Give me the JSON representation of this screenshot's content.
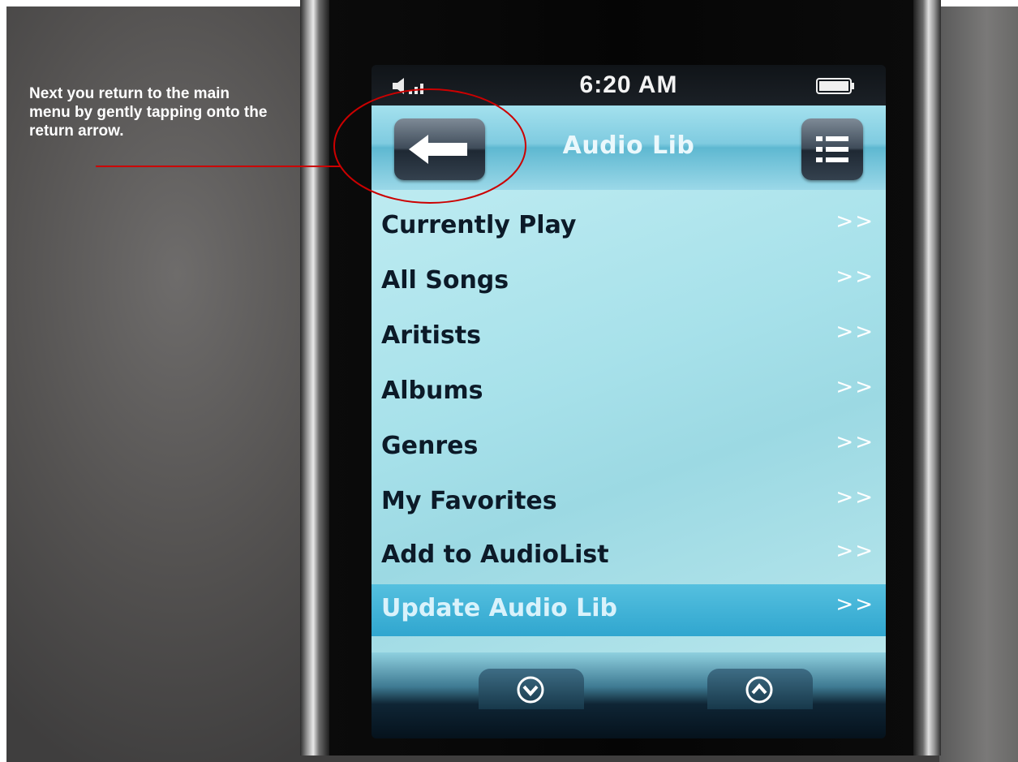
{
  "annotation": {
    "text": "Next you return to the main menu by gently tapping onto the return arrow.",
    "color": "#cc0000"
  },
  "status_bar": {
    "time": "6:20 AM",
    "signal_icon": "volume-signal-icon",
    "battery_icon": "battery-icon"
  },
  "header": {
    "title": "Audio Lib",
    "back_icon": "back-arrow-icon",
    "list_icon": "list-menu-icon"
  },
  "menu": {
    "items": [
      {
        "label": "Currently Play",
        "chevron": ">>"
      },
      {
        "label": "All Songs",
        "chevron": ">>"
      },
      {
        "label": "Aritists",
        "chevron": ">>"
      },
      {
        "label": "Albums",
        "chevron": ">>"
      },
      {
        "label": "Genres",
        "chevron": ">>"
      },
      {
        "label": "My Favorites",
        "chevron": ">>"
      },
      {
        "label": "Add to AudioList",
        "chevron": ">>"
      },
      {
        "label": "Update Audio Lib",
        "chevron": ">>",
        "selected": true
      }
    ]
  },
  "footer": {
    "down_icon": "scroll-down-icon",
    "up_icon": "scroll-up-icon"
  }
}
